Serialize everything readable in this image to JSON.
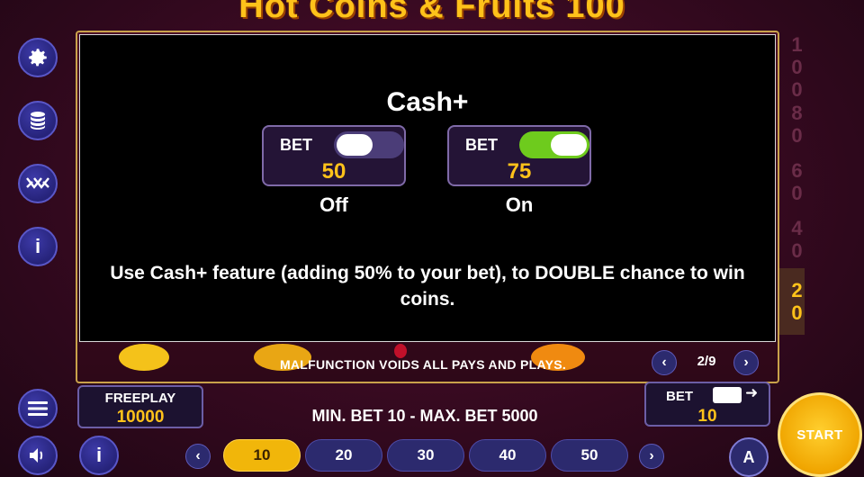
{
  "title": "Hot Coins & Fruits 100",
  "sidebar": {
    "settings_icon": "gear-icon",
    "coins_icon": "coin-stack-icon",
    "multiplier_icon": "cross-x-icon",
    "info_label": "i"
  },
  "overlay": {
    "title": "Cash+",
    "cards": [
      {
        "bet_label": "BET",
        "value": "50",
        "state": "Off",
        "toggle_on": false
      },
      {
        "bet_label": "BET",
        "value": "75",
        "state": "On",
        "toggle_on": true
      }
    ],
    "description": "Use Cash+ feature (adding 50% to your bet), to DOUBLE chance to win coins."
  },
  "ladder": {
    "values": [
      "100",
      "80",
      "60",
      "40",
      "20"
    ],
    "active_value": "20"
  },
  "footer": {
    "malfunction": "MALFUNCTION VOIDS ALL PAYS AND PLAYS.",
    "page_indicator": "2/9",
    "prev_label": "‹",
    "next_label": "›"
  },
  "freeplay": {
    "label": "FREEPLAY",
    "value": "10000"
  },
  "bet_limits": "MIN. BET 10 - MAX. BET 5000",
  "bet": {
    "label": "BET",
    "value": "10",
    "arrow": "➜"
  },
  "bet_chips": {
    "options": [
      "10",
      "20",
      "30",
      "40",
      "50"
    ],
    "selected": "10",
    "prev_label": "‹",
    "next_label": "›"
  },
  "menu_icon": "hamburger-menu-icon",
  "sound_icon": "speaker-icon",
  "bottom_info_label": "i",
  "auto_label": "A",
  "start_label": "START",
  "colors": {
    "accent_gold": "#ffc21a",
    "button_blue": "#2c2a6e",
    "toggle_on": "#6ecb1d",
    "toggle_off": "#4b3d78"
  }
}
